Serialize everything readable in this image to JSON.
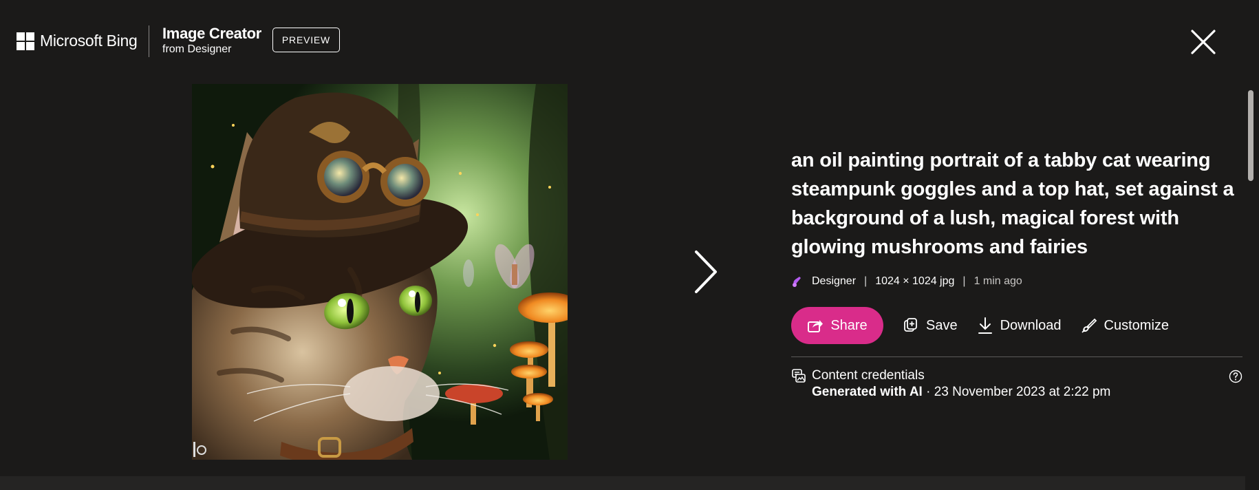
{
  "header": {
    "brand_name": "Microsoft Bing",
    "product_title": "Image Creator",
    "product_subtitle": "from Designer",
    "badge": "PREVIEW"
  },
  "image": {
    "alt": "an oil painting portrait of a tabby cat wearing steampunk goggles and a top hat, set against a background of a lush, magical forest with glowing mushrooms and fairies"
  },
  "details": {
    "prompt": "an oil painting portrait of a tabby cat wearing steampunk goggles and a top hat, set against a background of a lush, magical forest with glowing mushrooms and fairies",
    "meta": {
      "source": "Designer",
      "separator": "|",
      "dimensions": "1024 × 1024 jpg",
      "age": "1 min ago"
    },
    "actions": {
      "share": "Share",
      "save": "Save",
      "download": "Download",
      "customize": "Customize"
    },
    "credentials": {
      "title": "Content credentials",
      "generated": "Generated with AI",
      "date": " · 23 November 2023 at 2:22 pm"
    }
  },
  "colors": {
    "background": "#1b1a19",
    "share_accent": "#d92c8a",
    "designer_icon": "#b45cf0"
  },
  "icons": [
    "close-icon",
    "chevron-right-icon",
    "designer-icon",
    "share-icon",
    "save-collection-icon",
    "download-icon",
    "customize-brush-icon",
    "content-credentials-icon",
    "help-icon"
  ]
}
